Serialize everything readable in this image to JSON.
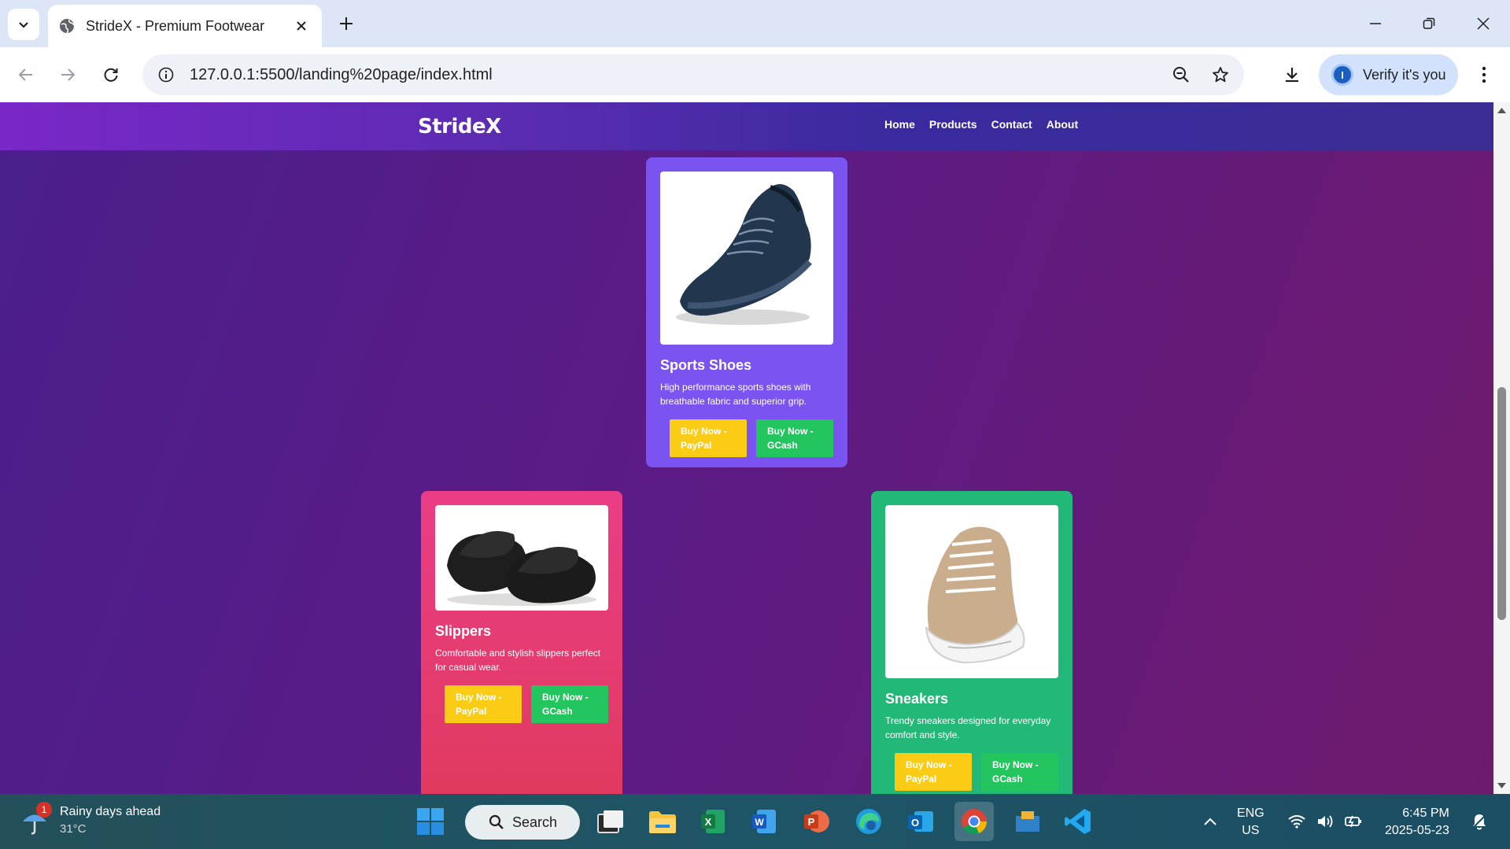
{
  "browser": {
    "tab_title": "StrideX - Premium Footwear",
    "url": "127.0.0.1:5500/landing%20page/index.html",
    "verify_label": "Verify it's you",
    "verify_avatar_letter": "I"
  },
  "site": {
    "brand": "StrideX",
    "nav": [
      "Home",
      "Products",
      "Contact",
      "About"
    ]
  },
  "products": [
    {
      "name": "Sports Shoes",
      "description": "High performance sports shoes with breathable fabric and superior grip.",
      "btn_paypal": "Buy Now - PayPal",
      "btn_gcash": "Buy Now - GCash",
      "color": "#7b53f0"
    },
    {
      "name": "Slippers",
      "description": "Comfortable and stylish slippers perfect for casual wear.",
      "btn_paypal": "Buy Now - PayPal",
      "btn_gcash": "Buy Now - GCash",
      "color": "#ea3d86"
    },
    {
      "name": "Sneakers",
      "description": "Trendy sneakers designed for everyday comfort and style.",
      "btn_paypal": "Buy Now - PayPal",
      "btn_gcash": "Buy Now - GCash",
      "color": "#22b877"
    }
  ],
  "taskbar": {
    "weather_title": "Rainy days ahead",
    "weather_temp": "31°C",
    "weather_badge": "1",
    "search_label": "Search",
    "lang_line1": "ENG",
    "lang_line2": "US",
    "time": "6:45 PM",
    "date": "2025-05-23"
  },
  "icons": {
    "tab_menu": "chevron-down-icon",
    "tab_favicon": "globe-icon",
    "tab_close": "close-icon",
    "new_tab": "plus-icon",
    "back": "arrow-left-icon",
    "forward": "arrow-right-icon",
    "reload": "reload-icon",
    "zoom": "zoom-icon",
    "bookmark": "star-icon",
    "download": "download-icon",
    "menu": "kebab-icon"
  }
}
